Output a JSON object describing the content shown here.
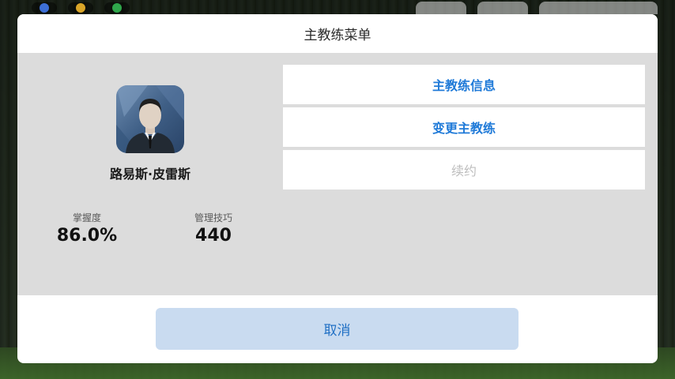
{
  "dialog": {
    "title": "主教练菜单",
    "coach": {
      "name": "路易斯·皮雷斯",
      "avatar_icon": "coach-portrait-icon"
    },
    "stats": [
      {
        "label": "掌握度",
        "value": "86.0%"
      },
      {
        "label": "管理技巧",
        "value": "440"
      }
    ],
    "menu": [
      {
        "label": "主教练信息",
        "enabled": true
      },
      {
        "label": "变更主教练",
        "enabled": true
      },
      {
        "label": "续约",
        "enabled": false
      }
    ],
    "cancel_label": "取消"
  },
  "colors": {
    "accent": "#1f7ad8",
    "disabled_text": "#bdbdbd",
    "body_bg": "#dcdcdc",
    "cancel_bg": "#c9dbf0"
  }
}
